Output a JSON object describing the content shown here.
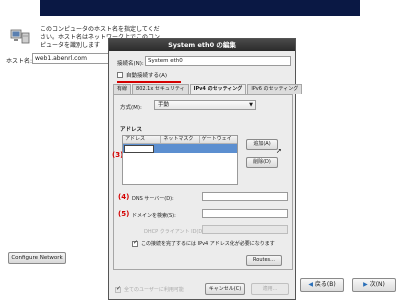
{
  "background": {
    "host_description": "このコンピュータのホスト名を指定してください。ホスト名はネットワーク上でこのコンピュータを識別します",
    "hostname_label": "ホスト名:",
    "hostname_value": "web1.abenrl.com",
    "configure_network_label": "Configure Network",
    "back_label": "戻る(B)",
    "next_label": "次(N)"
  },
  "dialog": {
    "title": "System eth0 の編集",
    "connection_name_label": "接続名(N):",
    "connection_name_value": "System eth0",
    "auto_connect_label": "自動接続する(A)",
    "tabs": [
      {
        "label": "有線"
      },
      {
        "label": "802.1x セキュリティ"
      },
      {
        "label": "IPv4 のセッティング",
        "active": true
      },
      {
        "label": "IPv6 のセッティング"
      }
    ],
    "method_label": "方式(M):",
    "method_value": "手動",
    "addresses_title": "アドレス",
    "address_columns": [
      "アドレス",
      "ネットマスク",
      "ゲートウェイ"
    ],
    "add_button": "追加(A)",
    "delete_button": "削除(D)",
    "dns_label": "DNS サーバー(D):",
    "search_domains_label": "ドメインを検索(S):",
    "dhcp_client_id_label": "DHCP クライアント ID(D):",
    "require_ipv4_label": "この接続を完了するには IPv4 アドレス化が必要になります",
    "routes_button": "Routes...",
    "all_users_label": "全てのユーザーに利用可能",
    "cancel_button": "キャンセル(C)",
    "apply_button": "適用..."
  },
  "annotations": {
    "mark3": "(3)",
    "mark4": "(4)",
    "mark5": "(5)"
  },
  "colors": {
    "annotation_red": "#d40000",
    "selection_blue": "#5c8fd0",
    "banner": "#0a1844"
  }
}
